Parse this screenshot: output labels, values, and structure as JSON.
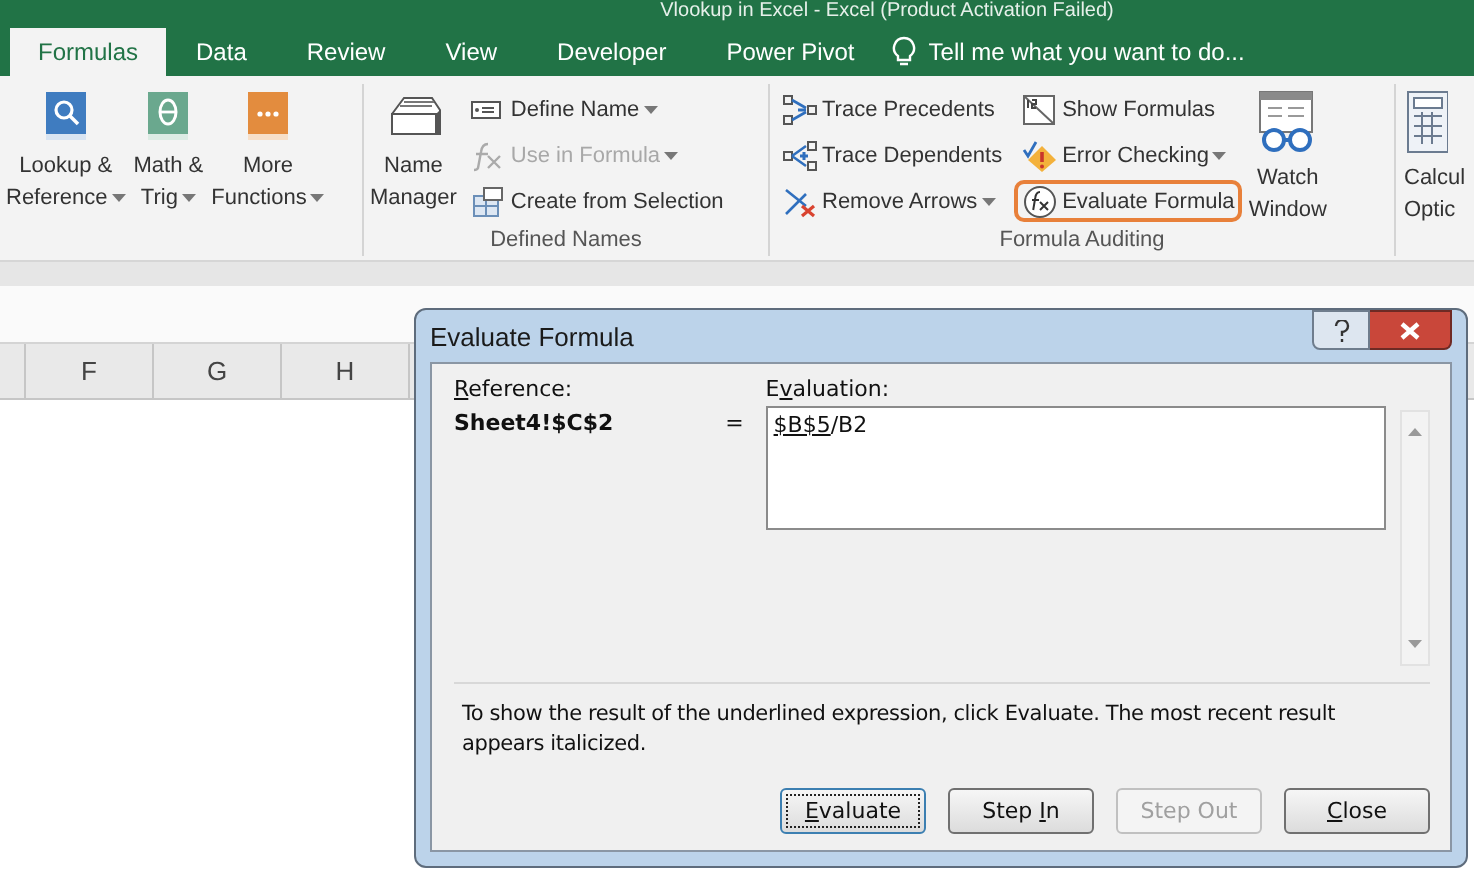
{
  "window": {
    "title": "Vlookup in Excel - Excel (Product Activation Failed)"
  },
  "tabs": [
    {
      "label": "Formulas",
      "selected": true
    },
    {
      "label": "Data",
      "selected": false
    },
    {
      "label": "Review",
      "selected": false
    },
    {
      "label": "View",
      "selected": false
    },
    {
      "label": "Developer",
      "selected": false
    },
    {
      "label": "Power Pivot",
      "selected": false
    }
  ],
  "tell_me": {
    "placeholder": "Tell me what you want to do..."
  },
  "ribbon": {
    "groups": [
      {
        "items": [
          {
            "kind": "large",
            "lines": [
              "Lookup &",
              "Reference"
            ],
            "dropdown": true
          },
          {
            "kind": "large",
            "lines": [
              "Math &",
              "Trig"
            ],
            "dropdown": true
          },
          {
            "kind": "large",
            "lines": [
              "More",
              "Functions"
            ],
            "dropdown": true
          }
        ]
      },
      {
        "label": "Defined Names",
        "items": [
          {
            "kind": "large",
            "lines": [
              "Name",
              "Manager"
            ],
            "dropdown": false
          },
          {
            "kind": "column",
            "items": [
              {
                "label": "Define Name",
                "dropdown": true,
                "disabled": false,
                "highlighted": false
              },
              {
                "label": "Use in Formula",
                "dropdown": true,
                "disabled": true,
                "highlighted": false
              },
              {
                "label": "Create from Selection",
                "dropdown": false,
                "disabled": false,
                "highlighted": false
              }
            ]
          }
        ]
      },
      {
        "label": "Formula Auditing",
        "items": [
          {
            "kind": "column",
            "items": [
              {
                "label": "Trace Precedents",
                "dropdown": false,
                "disabled": false,
                "highlighted": false
              },
              {
                "label": "Trace Dependents",
                "dropdown": false,
                "disabled": false,
                "highlighted": false
              },
              {
                "label": "Remove Arrows",
                "dropdown": true,
                "disabled": false,
                "highlighted": false
              }
            ]
          },
          {
            "kind": "column",
            "items": [
              {
                "label": "Show Formulas",
                "dropdown": false,
                "disabled": false,
                "highlighted": false
              },
              {
                "label": "Error Checking",
                "dropdown": true,
                "disabled": false,
                "highlighted": false
              },
              {
                "label": "Evaluate Formula",
                "dropdown": false,
                "disabled": false,
                "highlighted": true
              }
            ]
          },
          {
            "kind": "large",
            "lines": [
              "Watch",
              "Window"
            ],
            "dropdown": false
          }
        ]
      },
      {
        "items": [
          {
            "kind": "large",
            "lines": [
              "Calcul",
              "Optic"
            ],
            "dropdown": false
          }
        ]
      }
    ]
  },
  "sheet": {
    "columns": [
      "F",
      "G",
      "H"
    ]
  },
  "dialog": {
    "title": "Evaluate Formula",
    "reference": {
      "label": {
        "key": "R",
        "post": "eference:"
      },
      "value": "Sheet4!$C$2"
    },
    "equals": "=",
    "evaluation": {
      "label": {
        "pre": "E",
        "key": "v",
        "post": "aluation:"
      },
      "underlined": "$B$5",
      "rest": "/B2"
    },
    "message": "To show the result of the underlined expression, click Evaluate.  The most recent result appears italicized.",
    "buttons": [
      {
        "label": {
          "key": "E",
          "post": "valuate"
        },
        "disabled": false,
        "focused": true
      },
      {
        "label": {
          "pre": "Step ",
          "key": "I",
          "post": "n"
        },
        "disabled": false,
        "focused": false
      },
      {
        "label": {
          "pre": "Step Out"
        },
        "disabled": true,
        "focused": false
      },
      {
        "label": {
          "key": "C",
          "post": "lose"
        },
        "disabled": false,
        "focused": false
      }
    ]
  }
}
